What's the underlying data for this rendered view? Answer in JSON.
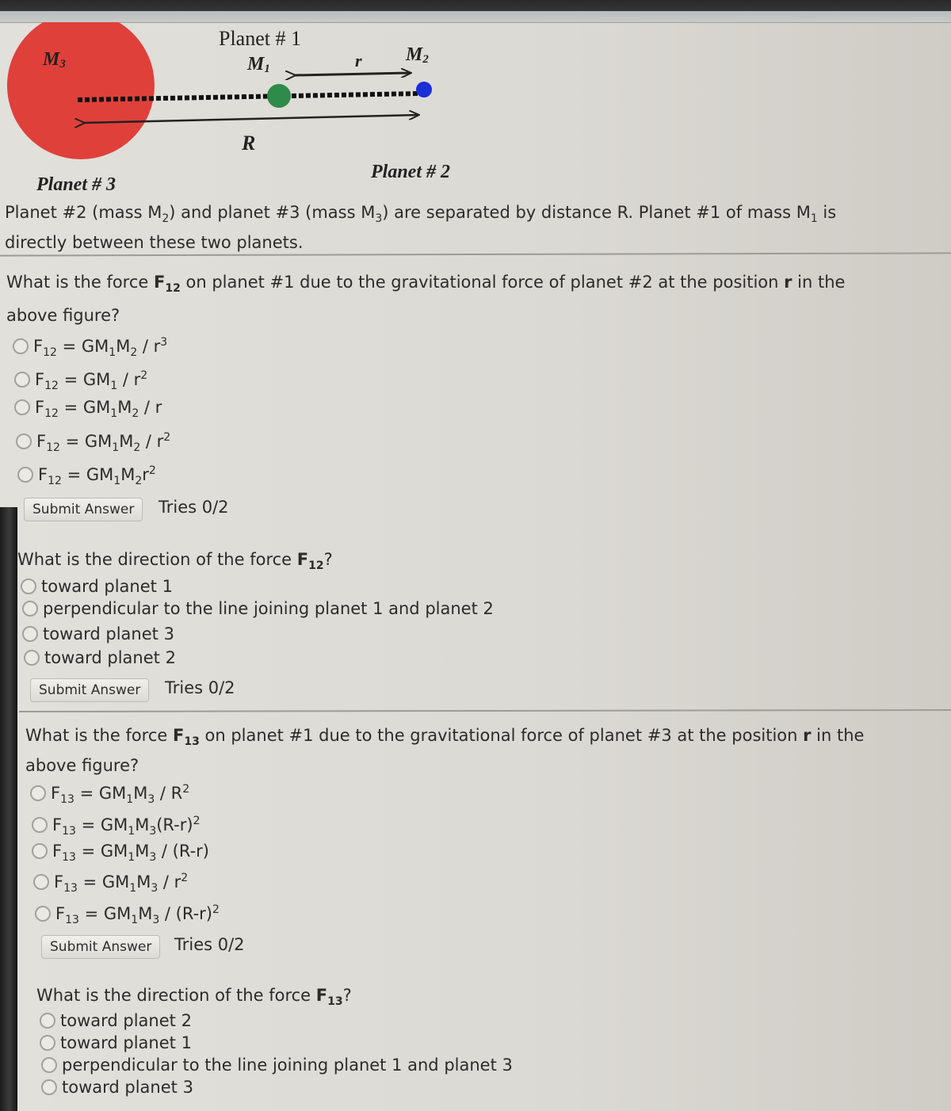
{
  "diagram": {
    "planet1_label": "Planet # 1",
    "planet2_label": "Planet # 2",
    "planet3_label": "Planet # 3",
    "m1_label": "M",
    "m1_sub": "1",
    "m2_label": "M",
    "m2_sub": "2",
    "m3_label": "M",
    "m3_sub": "3",
    "r_label": "r",
    "R_label": "R",
    "colors": {
      "planet3": "#e0403a",
      "planet1": "#2e8b4a",
      "planet2": "#1a2fd6"
    }
  },
  "intro": {
    "line1_a": "Planet #2 (mass M",
    "line1_sub1": "2",
    "line1_b": ") and planet #3 (mass M",
    "line1_sub2": "3",
    "line1_c": ") are separated by distance R. Planet #1 of mass M",
    "line1_sub3": "1",
    "line1_d": " is",
    "line2": "directly between these two planets."
  },
  "questions": [
    {
      "prompt_a": "What is the force ",
      "prompt_bold": "F",
      "prompt_bold_sub": "12",
      "prompt_b": " on planet #1 due to the gravitational force of planet #2 at the position ",
      "prompt_r": "r",
      "prompt_c": " in the",
      "prompt_line2": "above figure?",
      "options": [
        {
          "pre": "F",
          "sub": "12",
          "mid": " = GM",
          "s1": "1",
          "m2": "M",
          "s2": "2",
          "tail": " / r",
          "sup": "3"
        },
        {
          "pre": "F",
          "sub": "12",
          "mid": " = GM",
          "s1": "1",
          "m2": "",
          "s2": "",
          "tail": " / r",
          "sup": "2"
        },
        {
          "pre": "F",
          "sub": "12",
          "mid": " = GM",
          "s1": "1",
          "m2": "M",
          "s2": "2",
          "tail": " / r",
          "sup": ""
        },
        {
          "pre": "F",
          "sub": "12",
          "mid": " = GM",
          "s1": "1",
          "m2": "M",
          "s2": "2",
          "tail": " / r",
          "sup": "2"
        },
        {
          "pre": "F",
          "sub": "12",
          "mid": " = GM",
          "s1": "1",
          "m2": "M",
          "s2": "2",
          "tail": "r",
          "sup": "2"
        }
      ],
      "submit_label": "Submit Answer",
      "tries": "Tries 0/2"
    },
    {
      "prompt_a": "What is the direction of the force ",
      "prompt_bold": "F",
      "prompt_bold_sub": "12",
      "prompt_end": "?",
      "options": [
        "toward planet 1",
        "perpendicular to the line joining planet 1 and planet 2",
        "toward planet 3",
        "toward planet 2"
      ],
      "submit_label": "Submit Answer",
      "tries": "Tries 0/2"
    },
    {
      "prompt_a": "What is the force ",
      "prompt_bold": "F",
      "prompt_bold_sub": "13",
      "prompt_b": " on planet #1 due to the gravitational force of planet #3 at the position ",
      "prompt_r": "r",
      "prompt_c": " in the",
      "prompt_line2": "above figure?",
      "options": [
        {
          "pre": "F",
          "sub": "13",
          "mid": " = GM",
          "s1": "1",
          "m2": "M",
          "s2": "3",
          "tail": " / R",
          "sup": "2"
        },
        {
          "pre": "F",
          "sub": "13",
          "mid": " = GM",
          "s1": "1",
          "m2": "M",
          "s2": "3",
          "tail": "(R-r)",
          "sup": "2"
        },
        {
          "pre": "F",
          "sub": "13",
          "mid": " = GM",
          "s1": "1",
          "m2": "M",
          "s2": "3",
          "tail": " / (R-r)",
          "sup": ""
        },
        {
          "pre": "F",
          "sub": "13",
          "mid": " = GM",
          "s1": "1",
          "m2": "M",
          "s2": "3",
          "tail": " / r",
          "sup": "2"
        },
        {
          "pre": "F",
          "sub": "13",
          "mid": " = GM",
          "s1": "1",
          "m2": "M",
          "s2": "3",
          "tail": " / (R-r)",
          "sup": "2"
        }
      ],
      "submit_label": "Submit Answer",
      "tries": "Tries 0/2"
    },
    {
      "prompt_a": "What is the direction of the force ",
      "prompt_bold": "F",
      "prompt_bold_sub": "13",
      "prompt_end": "?",
      "options": [
        "toward planet 2",
        "toward planet 1",
        "perpendicular to the line joining planet 1 and planet 3",
        "toward planet 3"
      ]
    }
  ]
}
